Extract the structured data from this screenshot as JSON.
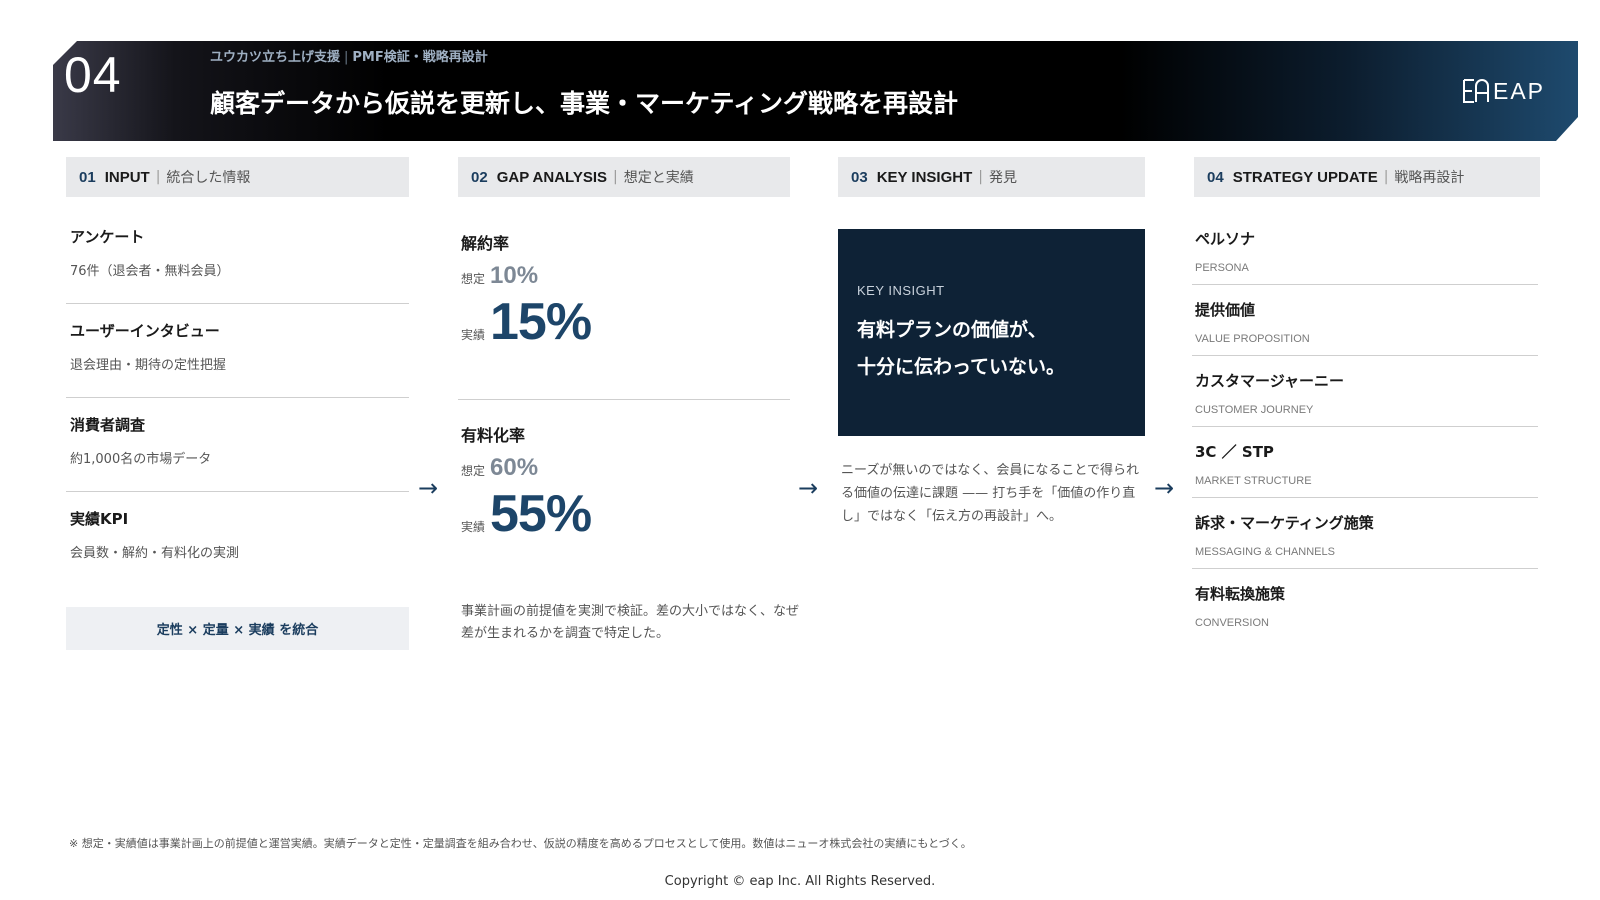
{
  "header": {
    "number": "04",
    "subtitle_left": "ユウカツ立ち上げ支援",
    "subtitle_sep": "|",
    "subtitle_right": "PMF検証・戦略再設計",
    "title": "顧客データから仮説を更新し、事業・マーケティング戦略を再設計",
    "logo_text": "EAP"
  },
  "columns": [
    {
      "num": "01",
      "en": "INPUT",
      "sep": "|",
      "jp": "統合した情報"
    },
    {
      "num": "02",
      "en": "GAP ANALYSIS",
      "sep": "|",
      "jp": "想定と実績"
    },
    {
      "num": "03",
      "en": "KEY INSIGHT",
      "sep": "|",
      "jp": "発見"
    },
    {
      "num": "04",
      "en": "STRATEGY UPDATE",
      "sep": "|",
      "jp": "戦略再設計"
    }
  ],
  "inputs": [
    {
      "title": "アンケート",
      "desc": "76件（退会者・無料会員）"
    },
    {
      "title": "ユーザーインタビュー",
      "desc": "退会理由・期待の定性把握"
    },
    {
      "title": "消費者調査",
      "desc": "約1,000名の市場データ"
    },
    {
      "title": "実績KPI",
      "desc": "会員数・解約・有料化の実測"
    }
  ],
  "integrate_label": "定性 × 定量 × 実績 を統合",
  "arrow": "→",
  "gap": [
    {
      "label": "解約率",
      "plan_key": "想定",
      "plan_value": "10%",
      "actual_key": "実績",
      "actual_value": "15%"
    },
    {
      "label": "有料化率",
      "plan_key": "想定",
      "plan_value": "60%",
      "actual_key": "実績",
      "actual_value": "55%"
    }
  ],
  "gap_note": "事業計画の前提値を実測で検証。差の大小ではなく、なぜ差が生まれるかを調査で特定した。",
  "insight": {
    "label": "KEY INSIGHT",
    "line1": "有料プランの価値が、",
    "line2": "十分に伝わっていない。",
    "note": "ニーズが無いのではなく、会員になることで得られる価値の伝達に課題 —— 打ち手を「価値の作り直し」ではなく「伝え方の再設計」へ。"
  },
  "strategy": [
    {
      "title": "ペルソナ",
      "en": "PERSONA"
    },
    {
      "title": "提供価値",
      "en": "VALUE PROPOSITION"
    },
    {
      "title": "カスタマージャーニー",
      "en": "CUSTOMER JOURNEY"
    },
    {
      "title": "3C ／ STP",
      "en": "MARKET STRUCTURE"
    },
    {
      "title": "訴求・マーケティング施策",
      "en": "MESSAGING & CHANNELS"
    },
    {
      "title": "有料転換施策",
      "en": "CONVERSION"
    }
  ],
  "footnote": "※ 想定・実績値は事業計画上の前提値と運営実績。実績データと定性・定量調査を組み合わせ、仮説の精度を高めるプロセスとして使用。数値はニューオ株式会社の実績にもとづく。",
  "copyright": "Copyright © eap Inc. All Rights Reserved.",
  "colors": {
    "navy": "#0e2236",
    "accent": "#1d4569",
    "muted": "#7d8895"
  }
}
